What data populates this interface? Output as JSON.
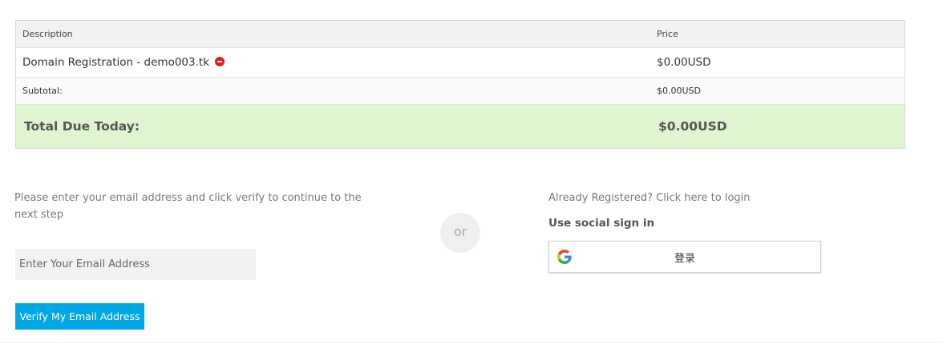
{
  "cart": {
    "headers": {
      "description": "Description",
      "price": "Price"
    },
    "item": {
      "description": "Domain Registration - demo003.tk",
      "price": "$0.00USD"
    },
    "subtotal": {
      "label": "Subtotal:",
      "value": "$0.00USD"
    },
    "total": {
      "label": "Total Due Today:",
      "value": "$0.00USD"
    }
  },
  "email_section": {
    "instructions": "Please enter your email address and click verify to continue to the next step",
    "placeholder": "Enter Your Email Address",
    "value": "",
    "verify_label": "Verify My Email Address"
  },
  "divider": {
    "label": "or"
  },
  "login_section": {
    "link_text": "Already Registered? Click here to login",
    "social_heading": "Use social sign in",
    "google_button_label": "登录"
  },
  "icons": {
    "remove": "remove-icon",
    "google": "google-icon"
  },
  "colors": {
    "total_row_bg": "#dff5cf",
    "verify_button_bg": "#00a9e6",
    "remove_icon": "#e11d1d",
    "header_row_bg": "#f2f2f2"
  }
}
